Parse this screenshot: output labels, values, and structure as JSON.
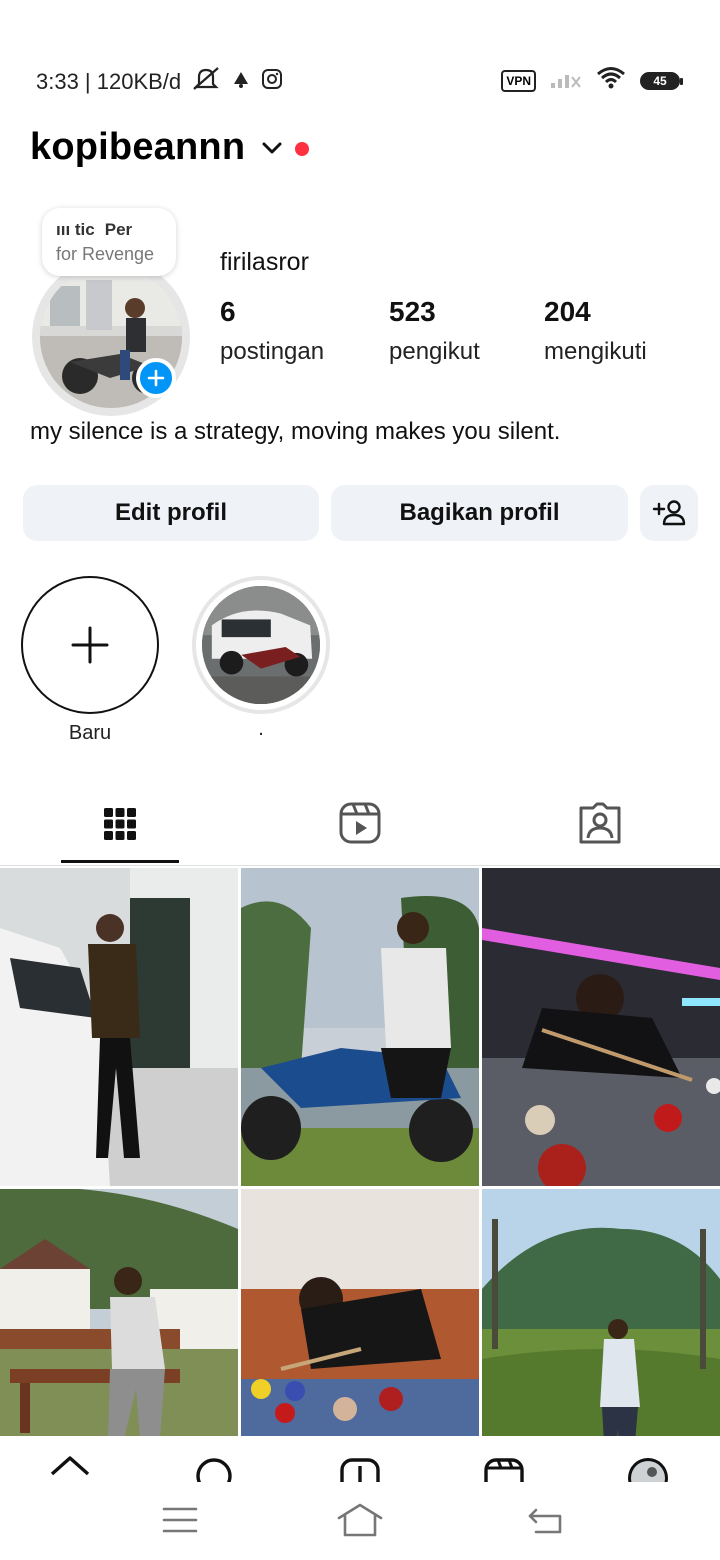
{
  "status_bar": {
    "time_text": "3:33 | 120KB/d",
    "vpn_label": "VPN",
    "battery_level": "45",
    "icons": [
      "mute-icon",
      "notification-icon",
      "instagram-icon",
      "signal-icon",
      "wifi-icon",
      "battery-icon"
    ]
  },
  "profile": {
    "username": "kopibeannn",
    "display_name": "firilasror",
    "note": {
      "line1_a": "ııı tic",
      "line1_b": "Per",
      "line2": "for Revenge"
    },
    "stats": [
      {
        "value": "6",
        "label": "postingan"
      },
      {
        "value": "523",
        "label": "pengikut"
      },
      {
        "value": "204",
        "label": "mengikuti"
      }
    ],
    "bio": "my silence is a strategy, moving makes you silent."
  },
  "buttons": {
    "edit_profile": "Edit profil",
    "share_profile": "Bagikan profil"
  },
  "highlights": [
    {
      "label": "Baru"
    },
    {
      "label": "."
    }
  ],
  "tabs": [
    "posts-grid",
    "reels",
    "tagged"
  ],
  "colors": {
    "accent_blue": "#0095f6",
    "notification_red": "#ff3040",
    "button_bg": "#eff2f6"
  }
}
